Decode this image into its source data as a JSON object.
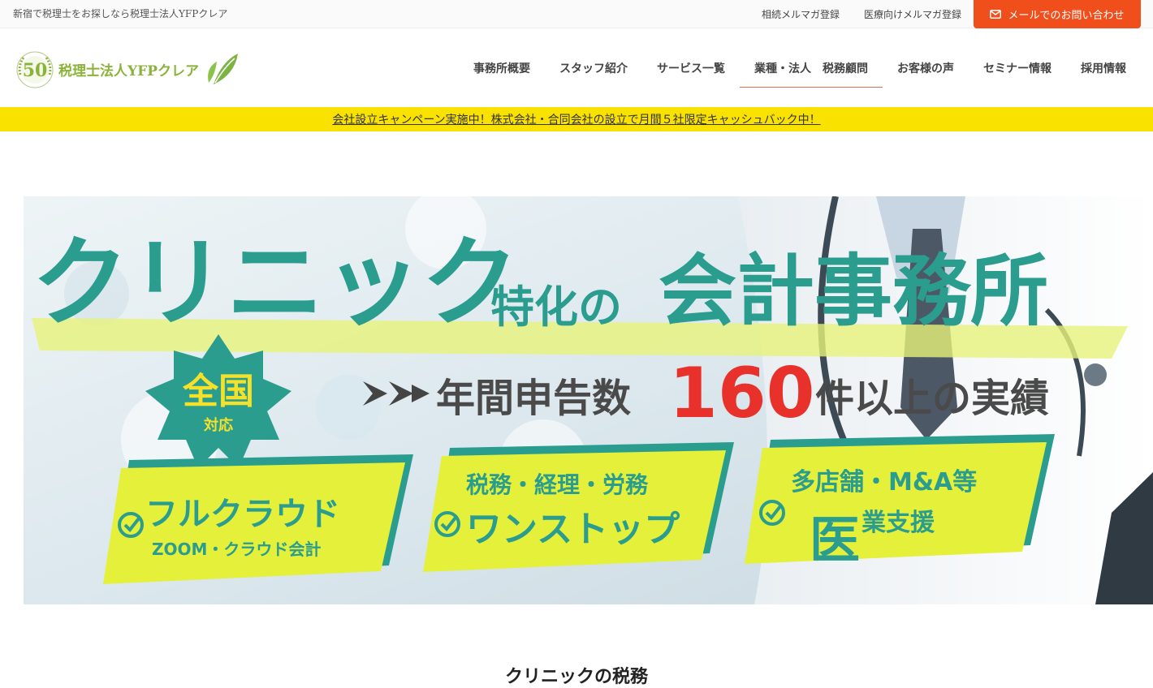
{
  "topbar": {
    "tagline": "新宿で税理士をお探しなら税理士法人YFPクレア",
    "links": [
      "相続メルマガ登録",
      "医療向けメルマガ登録"
    ],
    "mail_button": "メールでのお問い合わせ"
  },
  "logo": {
    "badge": "50",
    "name": "税理士法人YFPクレア"
  },
  "nav": {
    "items": [
      "事務所概要",
      "スタッフ紹介",
      "サービス一覧",
      "業種・法人　税務顧問",
      "お客様の声",
      "セミナー情報",
      "採用情報"
    ],
    "active_index": 3
  },
  "campaign": {
    "text": "会社設立キャンペーン実施中！株式会社・合同会社の設立で月間５社限定キャッシュバック中！"
  },
  "hero": {
    "headline_big": "クリニック",
    "headline_mid": "特化の",
    "headline_office": "会計事務所",
    "badge_main": "全国",
    "badge_sub": "対応",
    "record_prefix": "年間申告数",
    "record_number": "160",
    "record_suffix": "件以上の実績",
    "cards": [
      {
        "line1": "フルクラウド",
        "line2": "ZOOM・クラウド会計"
      },
      {
        "line1": "税務・経理・労務",
        "line2": "ワンストップ"
      },
      {
        "line1": "多店舗・M&A等",
        "line2_big": "医",
        "line2": "業支援"
      }
    ]
  },
  "section": {
    "title": "クリニックの税務"
  },
  "colors": {
    "accent": "#f04e1b",
    "campaign": "#f9e100",
    "teal": "#2a9d8f",
    "lime": "#e4f03a",
    "red": "#e8312b"
  }
}
